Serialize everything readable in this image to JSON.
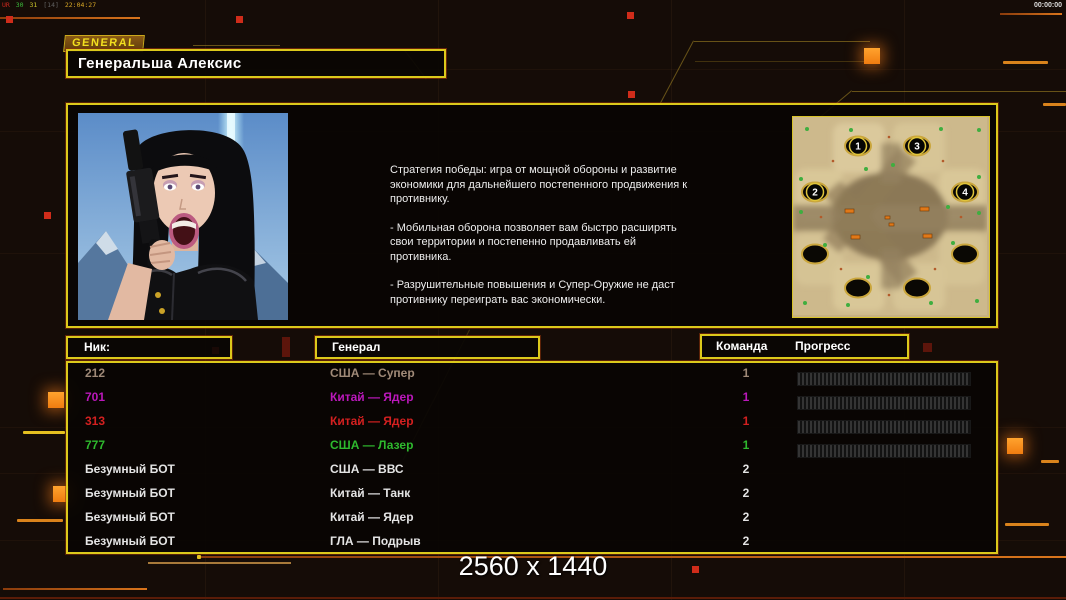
{
  "osd": {
    "segments": [
      {
        "text": "UR",
        "color": "#c8281e"
      },
      {
        "text": "30",
        "color": "#3cbb3c"
      },
      {
        "text": "31",
        "color": "#c8c32a"
      },
      {
        "text": "[14]",
        "color": "#5f5f5f"
      },
      {
        "text": "22:04:27",
        "color": "#d8a826"
      }
    ]
  },
  "clock": "00:00:00",
  "general_tag": "GENERAL",
  "title": "Генеральша Алексис",
  "strategy": {
    "p1": "Стратегия победы: игра от мощной обороны и развитие экономики для дальнейшего постепенного продвижения к противнику.",
    "p2": "- Мобильная оборона позволяет вам быстро расширять свои территории и постепенно продавливать ей противника.",
    "p3": "- Разрушительные повышения и Супер-Оружие не даст противнику переиграть вас экономически."
  },
  "map": {
    "badges": [
      "1",
      "2",
      "3",
      "4"
    ]
  },
  "table": {
    "headers": {
      "nick": "Ник:",
      "general": "Генерал",
      "team": "Команда",
      "progress": "Прогресс"
    },
    "rows": [
      {
        "nick": "212",
        "general": "США — Супер",
        "team": "1",
        "color": "#a08a78",
        "has_progress": true
      },
      {
        "nick": "701",
        "general": "Китай — Ядер",
        "team": "1",
        "color": "#bb18bb",
        "has_progress": true
      },
      {
        "nick": "313",
        "general": "Китай — Ядер",
        "team": "1",
        "color": "#d42020",
        "has_progress": true
      },
      {
        "nick": "777",
        "general": "США — Лазер",
        "team": "1",
        "color": "#2eb92e",
        "has_progress": true
      },
      {
        "nick": "Безумный БОТ",
        "general": "США — ВВС",
        "team": "2",
        "color": "#e4e4e4",
        "has_progress": false
      },
      {
        "nick": "Безумный БОТ",
        "general": "Китай — Танк",
        "team": "2",
        "color": "#e4e4e4",
        "has_progress": false
      },
      {
        "nick": "Безумный БОТ",
        "general": "Китай — Ядер",
        "team": "2",
        "color": "#e4e4e4",
        "has_progress": false
      },
      {
        "nick": "Безумный БОТ",
        "general": "ГЛА — Подрыв",
        "team": "2",
        "color": "#e4e4e4",
        "has_progress": false
      }
    ]
  },
  "resolution_label": "2560 x 1440",
  "colors": {
    "accent_yellow": "#dcc91b",
    "accent_orange": "#f07c10",
    "square_red": "#cf2c1a",
    "panel_bg": "#090503"
  }
}
